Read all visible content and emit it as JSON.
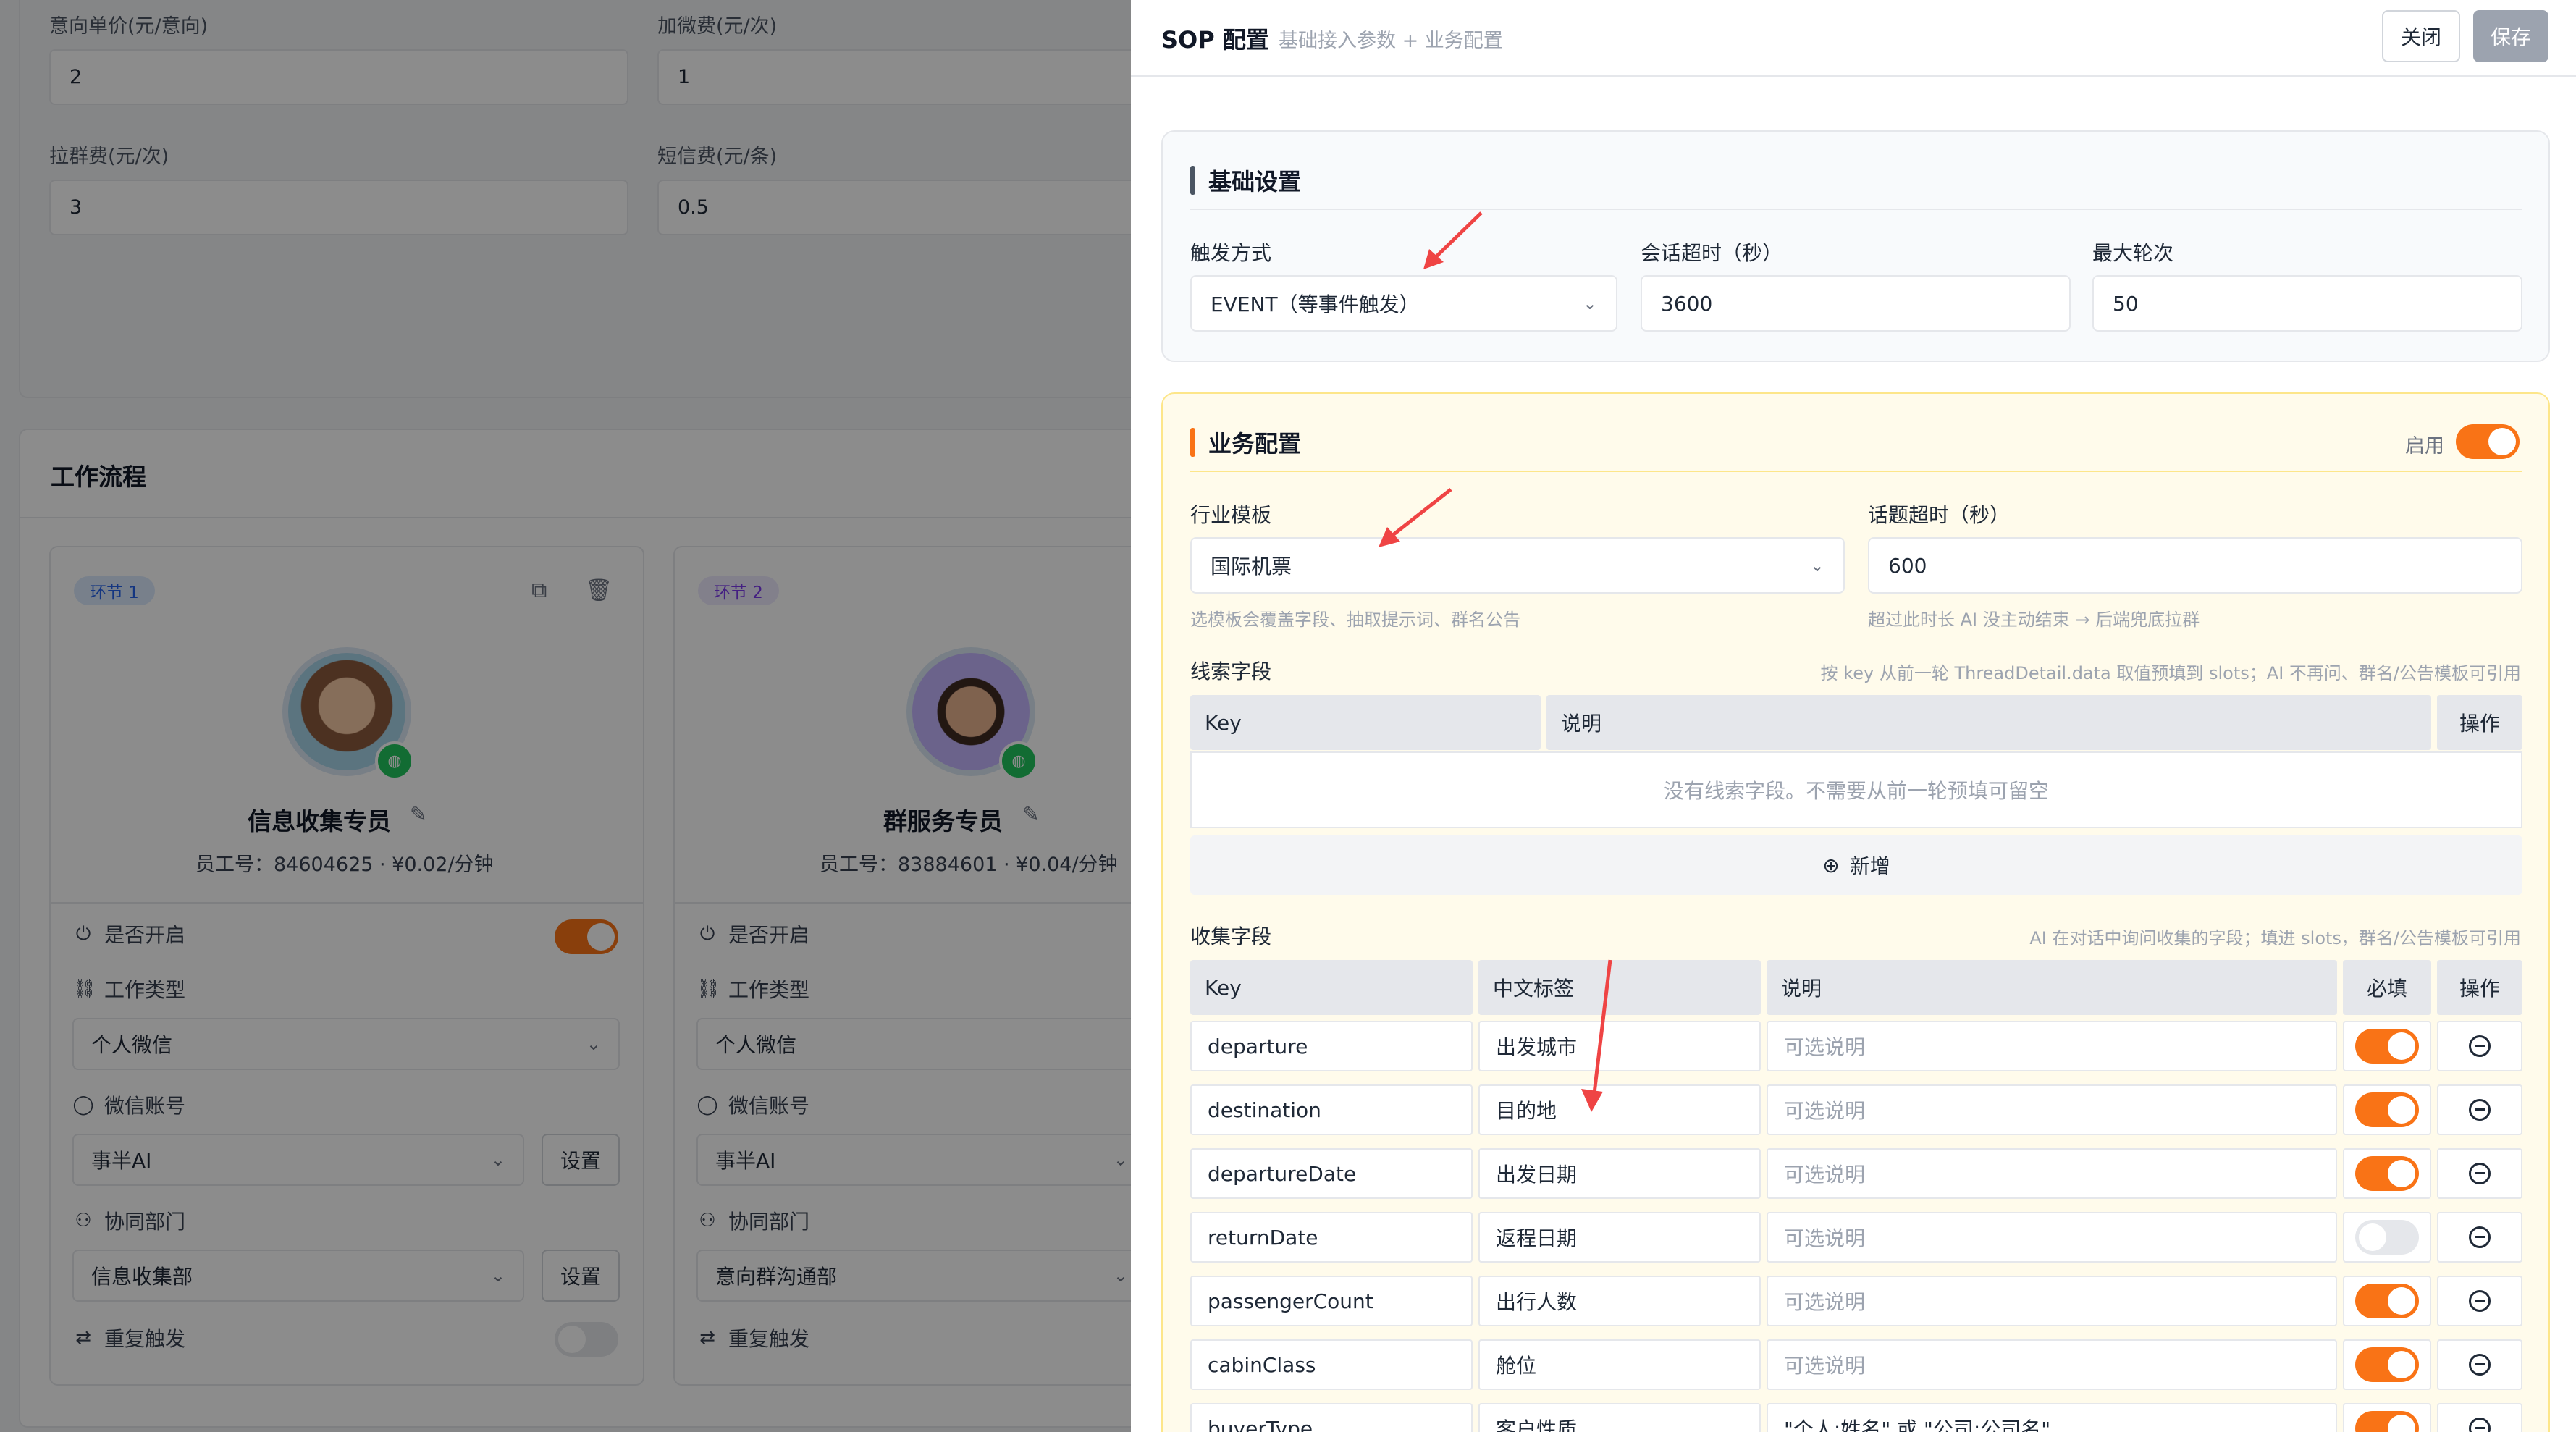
{
  "background": {
    "fields": [
      {
        "label": "意向单价(元/意向)",
        "value": "2"
      },
      {
        "label": "加微费(元/次)",
        "value": "1"
      },
      {
        "label": "拉群费(元/次)",
        "value": "3"
      },
      {
        "label": "短信费(元/条)",
        "value": "0.5"
      }
    ],
    "workflow_title": "工作流程",
    "workers": [
      {
        "tag": "环节 1",
        "name": "信息收集专员",
        "meta": "员工号：84604625 · ¥0.02/分钟",
        "enable_label": "是否开启",
        "enabled": true,
        "work_type_label": "工作类型",
        "work_type": "个人微信",
        "wechat_label": "微信账号",
        "wechat_account": "事半AI",
        "set_label": "设置",
        "dept_label": "协同部门",
        "dept": "信息收集部",
        "repeat_label": "重复触发",
        "repeat": false
      },
      {
        "tag": "环节 2",
        "name": "群服务专员",
        "meta": "员工号：83884601 · ¥0.04/分钟",
        "enable_label": "是否开启",
        "work_type_label": "工作类型",
        "work_type": "个人微信",
        "wechat_label": "微信账号",
        "wechat_account": "事半AI",
        "dept_label": "协同部门",
        "dept": "意向群沟通部",
        "repeat_label": "重复触发"
      }
    ]
  },
  "drawer": {
    "title": "SOP 配置",
    "subtitle": "基础接入参数 + 业务配置",
    "close_label": "关闭",
    "save_label": "保存",
    "basic": {
      "title": "基础设置",
      "trigger_label": "触发方式",
      "trigger_value": "EVENT（等事件触发）",
      "timeout_label": "会话超时（秒）",
      "timeout_value": "3600",
      "rounds_label": "最大轮次",
      "rounds_value": "50"
    },
    "business": {
      "title": "业务配置",
      "enable_label": "启用",
      "enabled": true,
      "template_label": "行业模板",
      "template_value": "国际机票",
      "template_hint": "选模板会覆盖字段、抽取提示词、群名公告",
      "topic_timeout_label": "话题超时（秒）",
      "topic_timeout_value": "600",
      "topic_timeout_hint": "超过此时长 AI 没主动结束 → 后端兜底拉群",
      "clue": {
        "title": "线索字段",
        "hint": "按 key 从前一轮 ThreadDetail.data 取值预填到 slots；AI 不再问、群名/公告模板可引用",
        "headers": [
          "Key",
          "说明",
          "操作"
        ],
        "empty": "没有线索字段。不需要从前一轮预填可留空",
        "add_label": "新增"
      },
      "collect": {
        "title": "收集字段",
        "hint": "AI 在对话中询问收集的字段；填进 slots，群名/公告模板可引用",
        "headers": [
          "Key",
          "中文标签",
          "说明",
          "必填",
          "操作"
        ],
        "desc_placeholder": "可选说明",
        "rows": [
          {
            "key": "departure",
            "label": "出发城市",
            "desc": "",
            "required": true
          },
          {
            "key": "destination",
            "label": "目的地",
            "desc": "",
            "required": true
          },
          {
            "key": "departureDate",
            "label": "出发日期",
            "desc": "",
            "required": true
          },
          {
            "key": "returnDate",
            "label": "返程日期",
            "desc": "",
            "required": false
          },
          {
            "key": "passengerCount",
            "label": "出行人数",
            "desc": "",
            "required": true
          },
          {
            "key": "cabinClass",
            "label": "舱位",
            "desc": "",
            "required": true
          },
          {
            "key": "buyerType",
            "label": "客户性质",
            "desc": "\"个人:姓名\" 或 \"公司:公司名\"",
            "required": true
          }
        ]
      }
    }
  },
  "colors": {
    "accent": "#f97316",
    "muted": "#9ca3af",
    "arrow": "#ef4444"
  }
}
